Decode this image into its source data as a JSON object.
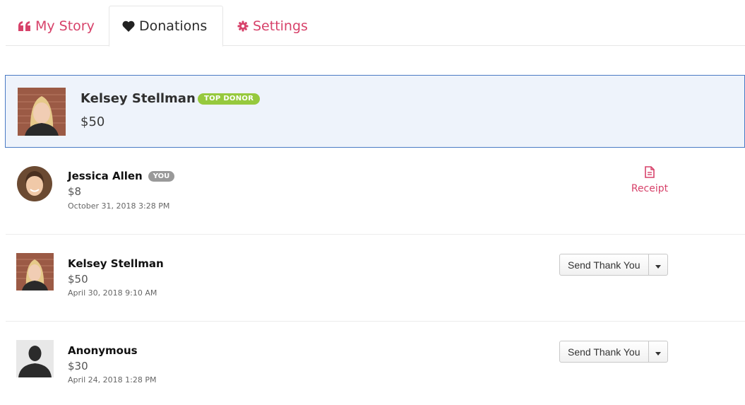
{
  "tabs": [
    {
      "label": "My Story",
      "icon": "quote-icon"
    },
    {
      "label": "Donations",
      "icon": "heart-icon",
      "active": true
    },
    {
      "label": "Settings",
      "icon": "gear-icon"
    }
  ],
  "colors": {
    "accent": "#d7426a",
    "top_donor_badge": "#96c93d",
    "you_badge": "#999999",
    "highlight_bg": "#eef3fb",
    "highlight_border": "#4a7bc4"
  },
  "top_donor": {
    "name": "Kelsey Stellman",
    "badge": "TOP DONOR",
    "amount": "$50"
  },
  "donations": [
    {
      "name": "Jessica Allen",
      "badge": "YOU",
      "amount": "$8",
      "date": "October 31, 2018 3:28 PM",
      "action": "Receipt"
    },
    {
      "name": "Kelsey Stellman",
      "amount": "$50",
      "date": "April 30, 2018 9:10 AM",
      "action": "Send Thank You"
    },
    {
      "name": "Anonymous",
      "amount": "$30",
      "date": "April 24, 2018 1:28 PM",
      "action": "Send Thank You"
    }
  ]
}
